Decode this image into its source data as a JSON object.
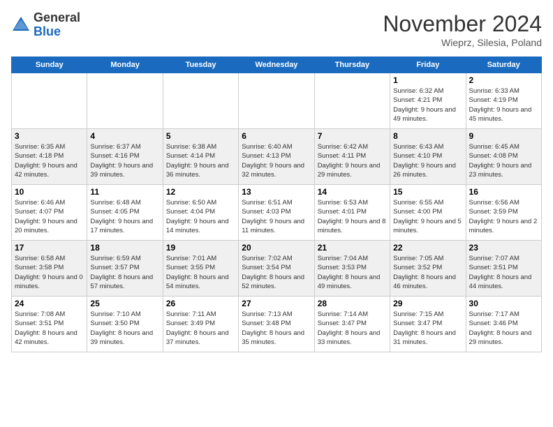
{
  "header": {
    "logo_general": "General",
    "logo_blue": "Blue",
    "month_title": "November 2024",
    "location": "Wieprz, Silesia, Poland"
  },
  "days_of_week": [
    "Sunday",
    "Monday",
    "Tuesday",
    "Wednesday",
    "Thursday",
    "Friday",
    "Saturday"
  ],
  "weeks": [
    [
      {
        "day": "",
        "info": ""
      },
      {
        "day": "",
        "info": ""
      },
      {
        "day": "",
        "info": ""
      },
      {
        "day": "",
        "info": ""
      },
      {
        "day": "",
        "info": ""
      },
      {
        "day": "1",
        "info": "Sunrise: 6:32 AM\nSunset: 4:21 PM\nDaylight: 9 hours and 49 minutes."
      },
      {
        "day": "2",
        "info": "Sunrise: 6:33 AM\nSunset: 4:19 PM\nDaylight: 9 hours and 45 minutes."
      }
    ],
    [
      {
        "day": "3",
        "info": "Sunrise: 6:35 AM\nSunset: 4:18 PM\nDaylight: 9 hours and 42 minutes."
      },
      {
        "day": "4",
        "info": "Sunrise: 6:37 AM\nSunset: 4:16 PM\nDaylight: 9 hours and 39 minutes."
      },
      {
        "day": "5",
        "info": "Sunrise: 6:38 AM\nSunset: 4:14 PM\nDaylight: 9 hours and 36 minutes."
      },
      {
        "day": "6",
        "info": "Sunrise: 6:40 AM\nSunset: 4:13 PM\nDaylight: 9 hours and 32 minutes."
      },
      {
        "day": "7",
        "info": "Sunrise: 6:42 AM\nSunset: 4:11 PM\nDaylight: 9 hours and 29 minutes."
      },
      {
        "day": "8",
        "info": "Sunrise: 6:43 AM\nSunset: 4:10 PM\nDaylight: 9 hours and 26 minutes."
      },
      {
        "day": "9",
        "info": "Sunrise: 6:45 AM\nSunset: 4:08 PM\nDaylight: 9 hours and 23 minutes."
      }
    ],
    [
      {
        "day": "10",
        "info": "Sunrise: 6:46 AM\nSunset: 4:07 PM\nDaylight: 9 hours and 20 minutes."
      },
      {
        "day": "11",
        "info": "Sunrise: 6:48 AM\nSunset: 4:05 PM\nDaylight: 9 hours and 17 minutes."
      },
      {
        "day": "12",
        "info": "Sunrise: 6:50 AM\nSunset: 4:04 PM\nDaylight: 9 hours and 14 minutes."
      },
      {
        "day": "13",
        "info": "Sunrise: 6:51 AM\nSunset: 4:03 PM\nDaylight: 9 hours and 11 minutes."
      },
      {
        "day": "14",
        "info": "Sunrise: 6:53 AM\nSunset: 4:01 PM\nDaylight: 9 hours and 8 minutes."
      },
      {
        "day": "15",
        "info": "Sunrise: 6:55 AM\nSunset: 4:00 PM\nDaylight: 9 hours and 5 minutes."
      },
      {
        "day": "16",
        "info": "Sunrise: 6:56 AM\nSunset: 3:59 PM\nDaylight: 9 hours and 2 minutes."
      }
    ],
    [
      {
        "day": "17",
        "info": "Sunrise: 6:58 AM\nSunset: 3:58 PM\nDaylight: 9 hours and 0 minutes."
      },
      {
        "day": "18",
        "info": "Sunrise: 6:59 AM\nSunset: 3:57 PM\nDaylight: 8 hours and 57 minutes."
      },
      {
        "day": "19",
        "info": "Sunrise: 7:01 AM\nSunset: 3:55 PM\nDaylight: 8 hours and 54 minutes."
      },
      {
        "day": "20",
        "info": "Sunrise: 7:02 AM\nSunset: 3:54 PM\nDaylight: 8 hours and 52 minutes."
      },
      {
        "day": "21",
        "info": "Sunrise: 7:04 AM\nSunset: 3:53 PM\nDaylight: 8 hours and 49 minutes."
      },
      {
        "day": "22",
        "info": "Sunrise: 7:05 AM\nSunset: 3:52 PM\nDaylight: 8 hours and 46 minutes."
      },
      {
        "day": "23",
        "info": "Sunrise: 7:07 AM\nSunset: 3:51 PM\nDaylight: 8 hours and 44 minutes."
      }
    ],
    [
      {
        "day": "24",
        "info": "Sunrise: 7:08 AM\nSunset: 3:51 PM\nDaylight: 8 hours and 42 minutes."
      },
      {
        "day": "25",
        "info": "Sunrise: 7:10 AM\nSunset: 3:50 PM\nDaylight: 8 hours and 39 minutes."
      },
      {
        "day": "26",
        "info": "Sunrise: 7:11 AM\nSunset: 3:49 PM\nDaylight: 8 hours and 37 minutes."
      },
      {
        "day": "27",
        "info": "Sunrise: 7:13 AM\nSunset: 3:48 PM\nDaylight: 8 hours and 35 minutes."
      },
      {
        "day": "28",
        "info": "Sunrise: 7:14 AM\nSunset: 3:47 PM\nDaylight: 8 hours and 33 minutes."
      },
      {
        "day": "29",
        "info": "Sunrise: 7:15 AM\nSunset: 3:47 PM\nDaylight: 8 hours and 31 minutes."
      },
      {
        "day": "30",
        "info": "Sunrise: 7:17 AM\nSunset: 3:46 PM\nDaylight: 8 hours and 29 minutes."
      }
    ]
  ]
}
